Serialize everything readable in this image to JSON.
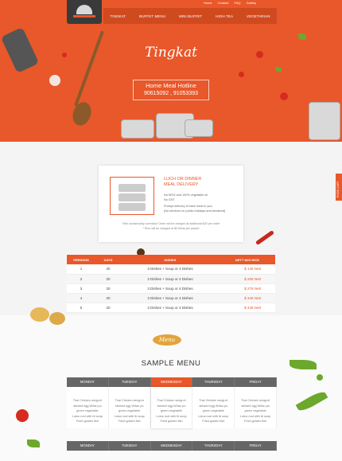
{
  "utility_nav": [
    "Home",
    "Contact",
    "FAQ",
    "Gallery"
  ],
  "main_nav": [
    "TINGKAT",
    "BUFFET MENU",
    "MINI BUFFET",
    "HIGH TEA",
    "VEGETARIAN"
  ],
  "hero": {
    "brand": "Tingkat",
    "hotline_title": "Home Meal Hotline",
    "hotline_phone": "90615092 , 91053393"
  },
  "side_tab": "FOOD CART",
  "delivery_card": {
    "title_line1": "LUCH OR DINNER",
    "title_line2": "MEAL DELIVERY",
    "line1": "No MSG and 100% vegetable oil",
    "line2": "No GST",
    "line3": "Prompt delivery of each meal to you",
    "line4": "(No services on public holidays and weekend)",
    "note1": "*Min occasionally correction Order will be charged at additional $20 per order",
    "note2": "* Rice will be charged at $0.50cts per packet"
  },
  "price_table": {
    "headers": [
      "PERSONS",
      "DAYS",
      "DISHES",
      "NETT W/O RICE"
    ],
    "rows": [
      [
        "1",
        "20",
        "3 Dishes + Soup or 4 Dishes",
        "$ 148 Nett"
      ],
      [
        "2",
        "20",
        "3 Dishes + Soup or 4 Dishes",
        "$ 208 Nett"
      ],
      [
        "3",
        "20",
        "3 Dishes + Soup or 4 Dishes",
        "$ 278 Nett"
      ],
      [
        "4",
        "20",
        "3 Dishes + Soup or 4 Dishes",
        "$ 348 Nett"
      ],
      [
        "5",
        "20",
        "3 Dishes + Soup or 4 Dishes",
        "$ 448 Nett"
      ]
    ]
  },
  "menu": {
    "badge": "Menu",
    "title": "SAMPLE MENU",
    "days": [
      "MONDAY",
      "TUESDAY",
      "WEDNESDAY",
      "THURSDAY",
      "FRIDAY"
    ],
    "active_day": "WEDNESDAY",
    "dishes": [
      "Thai Chicken wingLet",
      "stewed egg W/tau po",
      "green vegetable",
      "Lotus root with tb soup",
      "Fried golden fish"
    ]
  },
  "colors": {
    "accent": "#e8582a",
    "dark": "#3a3a3a",
    "header_gray": "#666666"
  }
}
